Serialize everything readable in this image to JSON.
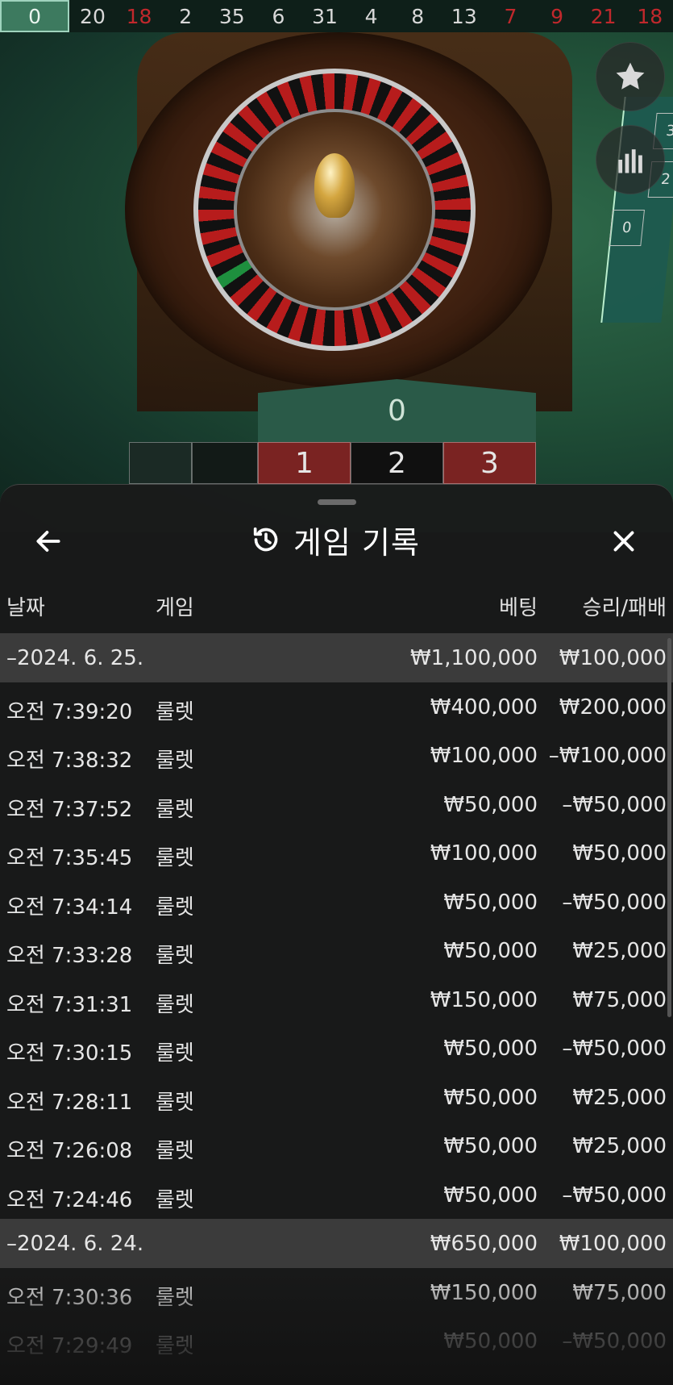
{
  "results_strip": {
    "items": [
      {
        "value": "0",
        "color": "green"
      },
      {
        "value": "20",
        "color": "black"
      },
      {
        "value": "18",
        "color": "red"
      },
      {
        "value": "2",
        "color": "black"
      },
      {
        "value": "35",
        "color": "black"
      },
      {
        "value": "6",
        "color": "black"
      },
      {
        "value": "31",
        "color": "black"
      },
      {
        "value": "4",
        "color": "black"
      },
      {
        "value": "8",
        "color": "black"
      },
      {
        "value": "13",
        "color": "black"
      },
      {
        "value": "7",
        "color": "red"
      },
      {
        "value": "9",
        "color": "red"
      },
      {
        "value": "21",
        "color": "red"
      },
      {
        "value": "18",
        "color": "red"
      }
    ]
  },
  "table": {
    "zero_label": "0",
    "grid_top": [
      "1",
      "2",
      "3"
    ],
    "mini_board": [
      "3",
      "2",
      "0"
    ]
  },
  "icons": {
    "favorite": "star-icon",
    "statistics": "bar-chart-icon",
    "back": "arrow-left-icon",
    "history": "history-icon",
    "close": "close-icon"
  },
  "sheet": {
    "title": "게임 기록",
    "columns": {
      "date": "날짜",
      "game": "게임",
      "bet": "베팅",
      "winloss": "승리/패배"
    },
    "groups": [
      {
        "date": "–2024. 6. 25.",
        "bet_total": "₩1,100,000",
        "winloss_total": "₩100,000",
        "rows": [
          {
            "time": "오전 7:39:20",
            "game": "룰렛",
            "bet": "₩400,000",
            "winloss": "₩200,000"
          },
          {
            "time": "오전 7:38:32",
            "game": "룰렛",
            "bet": "₩100,000",
            "winloss": "–₩100,000"
          },
          {
            "time": "오전 7:37:52",
            "game": "룰렛",
            "bet": "₩50,000",
            "winloss": "–₩50,000"
          },
          {
            "time": "오전 7:35:45",
            "game": "룰렛",
            "bet": "₩100,000",
            "winloss": "₩50,000"
          },
          {
            "time": "오전 7:34:14",
            "game": "룰렛",
            "bet": "₩50,000",
            "winloss": "–₩50,000"
          },
          {
            "time": "오전 7:33:28",
            "game": "룰렛",
            "bet": "₩50,000",
            "winloss": "₩25,000"
          },
          {
            "time": "오전 7:31:31",
            "game": "룰렛",
            "bet": "₩150,000",
            "winloss": "₩75,000"
          },
          {
            "time": "오전 7:30:15",
            "game": "룰렛",
            "bet": "₩50,000",
            "winloss": "–₩50,000"
          },
          {
            "time": "오전 7:28:11",
            "game": "룰렛",
            "bet": "₩50,000",
            "winloss": "₩25,000"
          },
          {
            "time": "오전 7:26:08",
            "game": "룰렛",
            "bet": "₩50,000",
            "winloss": "₩25,000"
          },
          {
            "time": "오전 7:24:46",
            "game": "룰렛",
            "bet": "₩50,000",
            "winloss": "–₩50,000"
          }
        ]
      },
      {
        "date": "–2024. 6. 24.",
        "bet_total": "₩650,000",
        "winloss_total": "₩100,000",
        "rows": [
          {
            "time": "오전 7:30:36",
            "game": "룰렛",
            "bet": "₩150,000",
            "winloss": "₩75,000"
          },
          {
            "time": "오전 7:29:49",
            "game": "룰렛",
            "bet": "₩50,000",
            "winloss": "–₩50,000"
          }
        ]
      }
    ]
  }
}
